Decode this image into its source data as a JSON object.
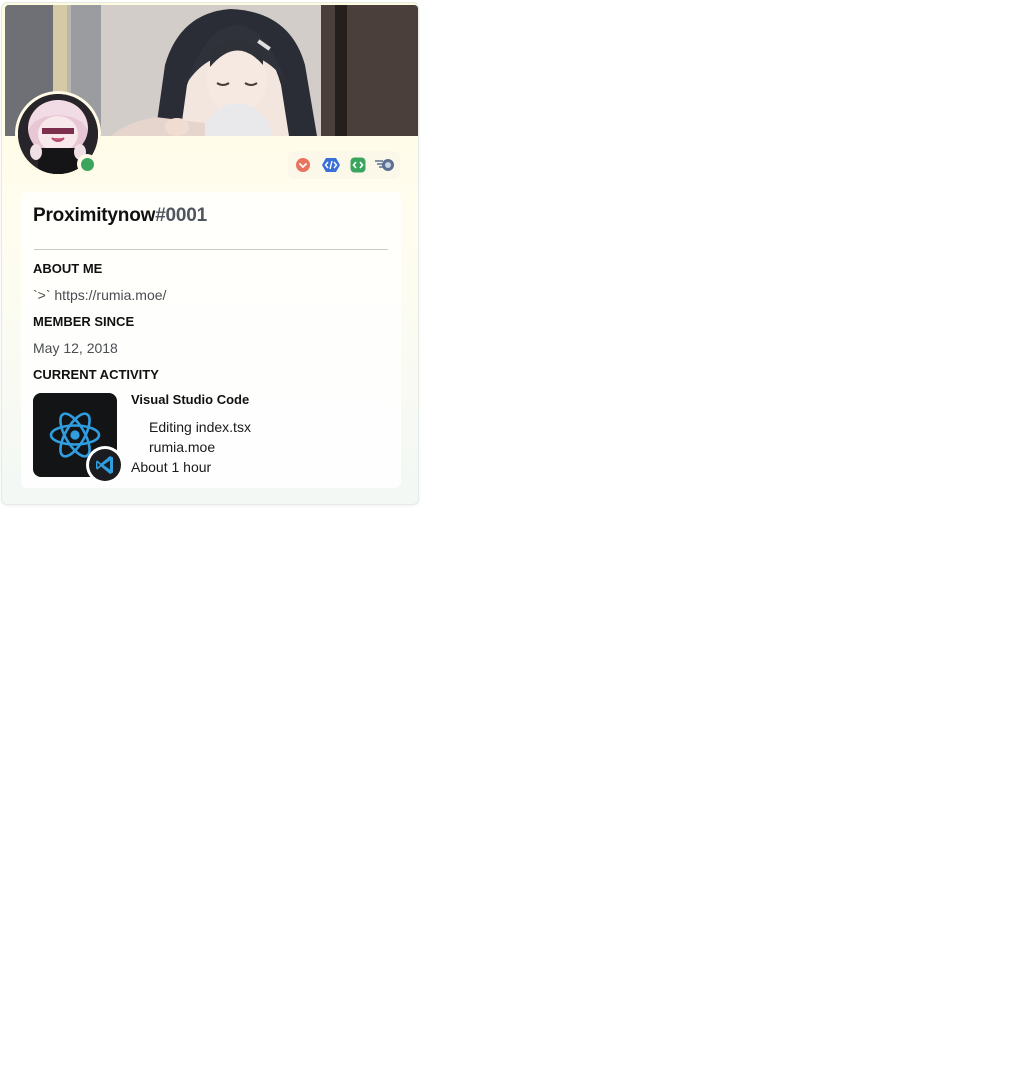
{
  "profile": {
    "username": "Proximitynow",
    "discriminator": "#0001",
    "status": "online",
    "status_color": "#3ba55d"
  },
  "badges": [
    {
      "icon": "bug-hunter-badge-icon",
      "color": "#e8735f"
    },
    {
      "icon": "active-developer-badge-icon",
      "color": "#3a6ed8"
    },
    {
      "icon": "verified-developer-badge-icon",
      "color": "#3ba55d"
    },
    {
      "icon": "hypesquad-speed-badge-icon",
      "color": "#5c6f92"
    }
  ],
  "sections": {
    "about_title": "ABOUT ME",
    "about_text": "`>` https://rumia.moe/",
    "member_title": "MEMBER SINCE",
    "member_text": "May 12, 2018",
    "activity_title": "CURRENT ACTIVITY"
  },
  "activity": {
    "name": "Visual Studio Code",
    "details": "Editing index.tsx",
    "state": "rumia.moe",
    "elapsed": "About 1 hour",
    "large_image_icon": "react-logo-icon",
    "small_image_icon": "vscode-logo-icon",
    "accent": "#2f9de0"
  }
}
